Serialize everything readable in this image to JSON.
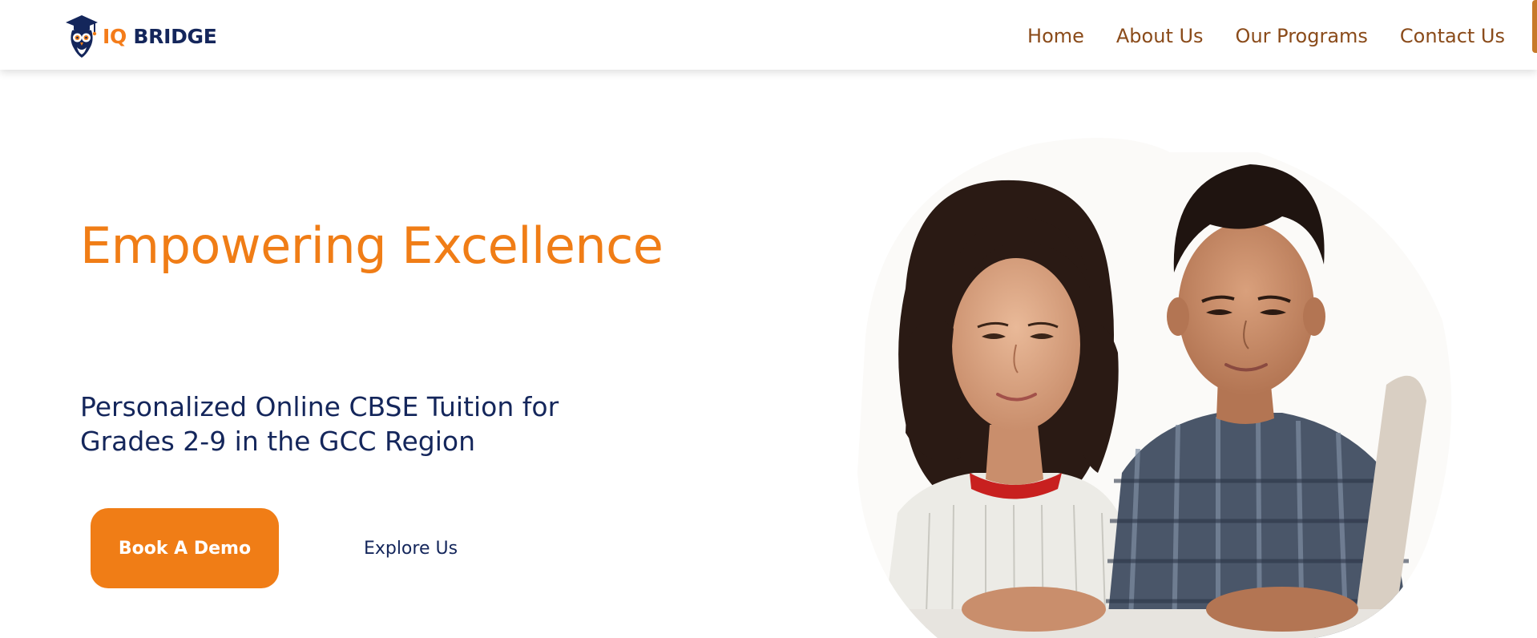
{
  "brand": {
    "name_part1": "IQ",
    "name_part2": "BRIDGE",
    "logo_icon": "owl-graduation-cap-icon",
    "color_primary": "#f07d16",
    "color_secondary": "#14265b"
  },
  "nav": {
    "items": [
      {
        "label": "Home"
      },
      {
        "label": "About Us"
      },
      {
        "label": "Our Programs"
      },
      {
        "label": "Contact Us"
      }
    ],
    "link_color": "#8a4b1a"
  },
  "hero": {
    "headline": "Empowering Excellence",
    "subtitle": "Personalized Online CBSE Tuition for Grades 2-9 in the GCC Region",
    "primary_button": "Book A Demo",
    "secondary_button": "Explore Us",
    "image": {
      "subject": "two-children-studying-at-laptop-photo"
    }
  }
}
